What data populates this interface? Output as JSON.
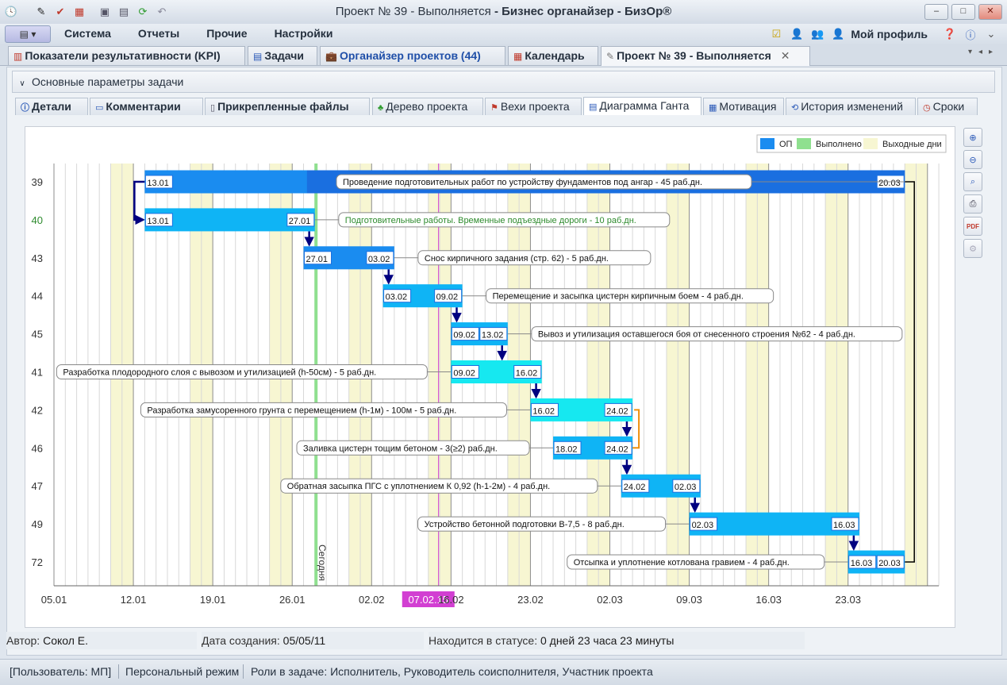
{
  "window": {
    "title_plain": "Проект № 39 - Выполняется",
    "title_bold": "Бизнес органайзер - БизОр®",
    "title_sep": " - ",
    "controls": [
      "–",
      "□",
      "✕"
    ]
  },
  "menu": {
    "items": [
      "Система",
      "Отчеты",
      "Прочие",
      "Настройки"
    ],
    "profile": "Мой профиль"
  },
  "doc_tabs": [
    {
      "label": "Показатели результативности (KPI)",
      "icon": "chart-icon"
    },
    {
      "label": "Задачи",
      "icon": "tasks-icon"
    },
    {
      "label": "Органайзер проектов (44)",
      "icon": "briefcase-icon",
      "color": "#1f4fa8"
    },
    {
      "label": "Календарь",
      "icon": "calendar-icon"
    },
    {
      "label": "Проект № 39 - Выполняется",
      "icon": "project-icon",
      "active": true
    }
  ],
  "collapsible_label": "Основные параметры задачи",
  "sub_tabs": [
    {
      "label": "Детали",
      "icon": "info-icon"
    },
    {
      "label": "Комментарии",
      "icon": "comment-icon"
    },
    {
      "label": "Прикрепленные файлы",
      "icon": "attach-icon"
    },
    {
      "label": "Дерево проекта",
      "icon": "tree-icon"
    },
    {
      "label": "Вехи проекта",
      "icon": "milestone-icon"
    },
    {
      "label": "Диаграмма Ганта",
      "icon": "gantt-icon",
      "active": true
    },
    {
      "label": "Мотивация",
      "icon": "motivation-icon"
    },
    {
      "label": "История изменений",
      "icon": "history-icon"
    },
    {
      "label": "Сроки",
      "icon": "clock-icon"
    }
  ],
  "gantt": {
    "legend": [
      "ОП",
      "Выполнено",
      "Выходные дни"
    ],
    "colors": {
      "op": "#1a8cf0",
      "done": "#8fe08f",
      "weekend": "#f7f6d2",
      "grid": "#d8d8d8",
      "arrow": "#000080",
      "today": "#8fe08f",
      "current": "#d23fd2"
    },
    "date_ticks": [
      "05.01",
      "12.01",
      "19.01",
      "26.01",
      "02.02",
      "07.02.15",
      "16.02",
      "23.02",
      "02.03",
      "09.03",
      "16.03",
      "23.03"
    ],
    "today_label": "Сегодня",
    "current_date": "07.02.15",
    "tasks": [
      {
        "id": "39",
        "start": "13.01",
        "end": "20.03",
        "label": "Проведение подготовительных работ по устройству фундаментов под ангар - 45 раб.дн."
      },
      {
        "id": "40",
        "start": "13.01",
        "end": "27.01",
        "label": "Подготовительные работы. Временные подъездные дороги - 10 раб.дн."
      },
      {
        "id": "43",
        "start": "27.01",
        "end": "03.02",
        "label": "Снос кирпичного задания (стр. 62) - 5 раб.дн."
      },
      {
        "id": "44",
        "start": "03.02",
        "end": "09.02",
        "label": "Перемещение и засыпка цистерн кирпичным боем - 4 раб.дн."
      },
      {
        "id": "45",
        "start": "09.02",
        "end": "13.02",
        "label": "Вывоз и утилизация оставшегося боя от снесенного строения №62 - 4 раб.дн."
      },
      {
        "id": "41",
        "start": "09.02",
        "end": "16.02",
        "label": "Разработка плодородного слоя с вывозом и утилизацией (h-50см) - 5 раб.дн."
      },
      {
        "id": "42",
        "start": "16.02",
        "end": "24.02",
        "label": "Разработка замусоренного грунта с перемещением (h-1м) - 100м - 5 раб.дн."
      },
      {
        "id": "46",
        "start": "18.02",
        "end": "24.02",
        "label": "Заливка цистерн тощим бетоном - 3(≥2) раб.дн."
      },
      {
        "id": "47",
        "start": "24.02",
        "end": "02.03",
        "label": "Обратная засыпка ПГС с уплотнением К 0,92 (h-1-2м) - 4 раб.дн."
      },
      {
        "id": "49",
        "start": "02.03",
        "end": "16.03",
        "label": "Устройство бетонной подготовки В-7,5 - 8 раб.дн."
      },
      {
        "id": "72",
        "start": "16.03",
        "end": "20.03",
        "label": "Отсыпка и уплотнение котлована гравием - 4 раб.дн."
      }
    ]
  },
  "info": {
    "author_label": "Автор:",
    "author": "Сокол Е.",
    "created_label": "Дата создания:",
    "created": "05/05/11",
    "status_label": "Находится в статусе:",
    "status": "0 дней 23 часа 23 минуты"
  },
  "statusbar": {
    "user": "[Пользователь: МП]",
    "mode": "Персональный режим",
    "roles": "Роли в задаче: Исполнитель, Руководитель соисполнителя, Участник проекта"
  }
}
